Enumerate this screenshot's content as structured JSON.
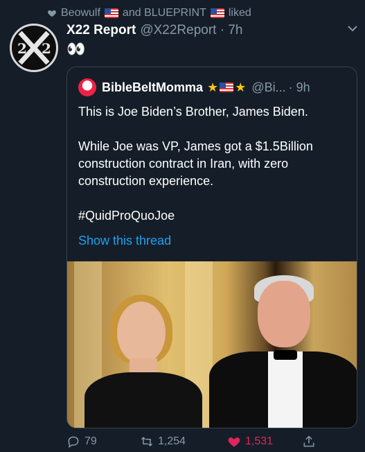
{
  "social_context": {
    "text_user1": "Beowulf",
    "text_and": "and BLUEPRINT",
    "text_liked": "liked"
  },
  "tweet": {
    "author_name": "X22 Report",
    "author_handle_time": "@X22Report · 7h",
    "body": "👀",
    "avatar_text_left": "2",
    "avatar_text_right": "2"
  },
  "quoted_tweet": {
    "author_name": "BibleBeltMomma",
    "author_handle": "@Bi...",
    "time": "· 9h",
    "text": "This is Joe Biden’s Brother,  James Biden.\n\nWhile Joe was VP, James got a $1.5Billion construction contract in Iran, with zero construction experience.\n\n#QuidProQuoJoe",
    "show_thread": "Show this thread"
  },
  "actions": {
    "replies": "79",
    "retweets": "1,254",
    "likes": "1,531"
  },
  "colors": {
    "background": "#151e28",
    "muted": "#8899a6",
    "link": "#1da1f2",
    "like": "#e0245e"
  }
}
